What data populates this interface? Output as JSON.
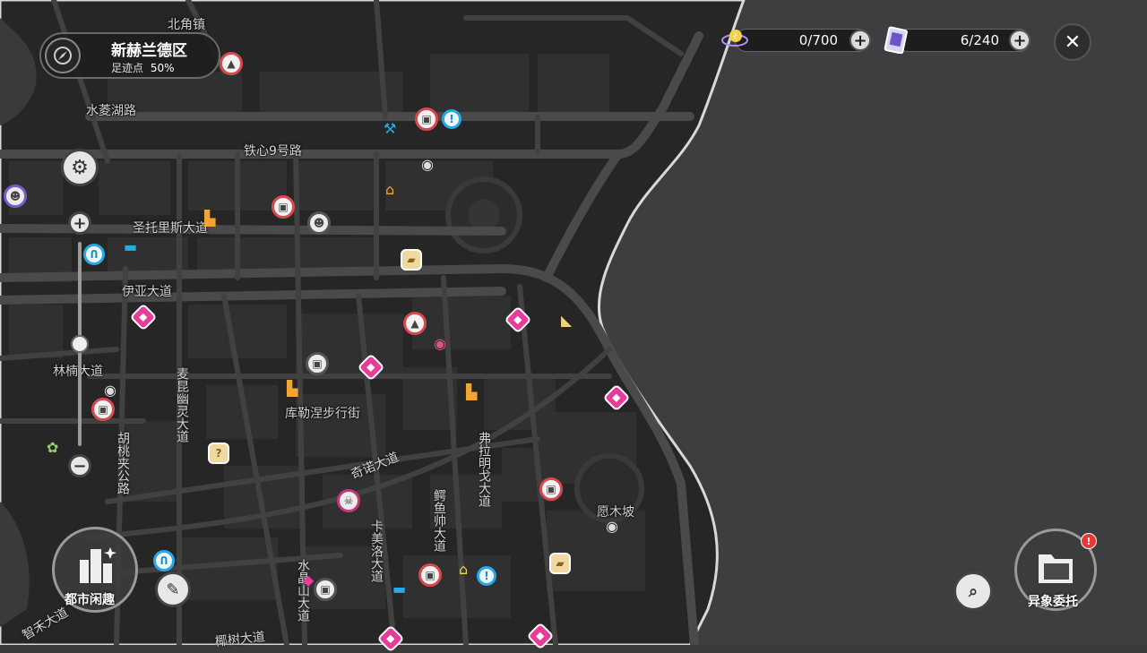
{
  "region": {
    "name": "新赫兰德区",
    "progress_label": "足迹点",
    "progress_value": "50%"
  },
  "resources": [
    {
      "icon": "battery-charge-icon",
      "value": "0/700"
    },
    {
      "icon": "card-ticket-icon",
      "value": "6/240"
    }
  ],
  "map_labels": {
    "beijiao": "北角镇",
    "shuiling": "水菱湖路",
    "tiexin": "铁心9号路",
    "shengtuo": "圣托里斯大道",
    "yiya": "伊亚大道",
    "linshan": "林楠大道",
    "kule": "库勒涅步行街",
    "qinuo": "奇诺大道",
    "yuanmu": "愿木坡",
    "meikun": "麦昆幽灵大道",
    "hutao": "胡桃夹公路",
    "fula": "弗拉明戈大道",
    "eyu": "鳄鱼帅大道",
    "kamei": "卡美洛大道",
    "shuijing": "水晶山大道",
    "yeshu": "椰树大道",
    "zhihe": "智禾大道"
  },
  "buttons": {
    "city_leisure": "都市闲趣",
    "anomaly_commission": "异象委托",
    "zoom_in": "+",
    "zoom_out": "−",
    "plus": "+",
    "close": "✕"
  },
  "colors": {
    "water": "#3f3f41",
    "land": "#2a2a2a",
    "road": "#474747",
    "accent_red": "#d9484f",
    "accent_pink": "#e83c9b",
    "accent_blue": "#29a8e6"
  }
}
